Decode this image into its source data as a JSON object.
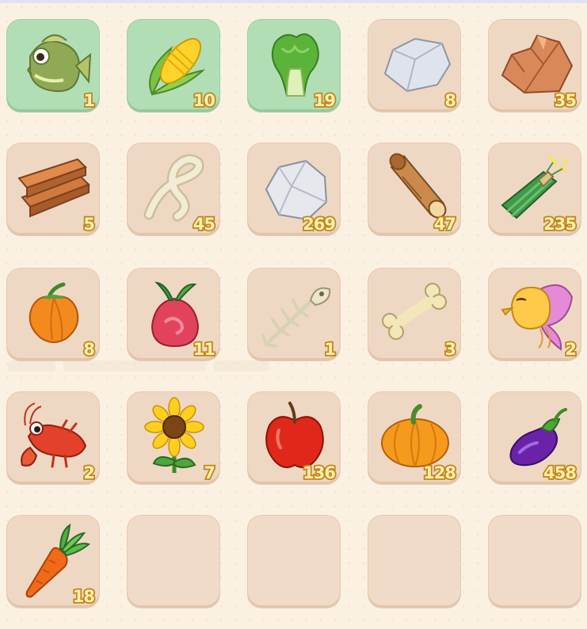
{
  "inventory": {
    "slots": [
      {
        "item": "fish-icon",
        "count": "1",
        "highlighted": true
      },
      {
        "item": "corn-icon",
        "count": "10",
        "highlighted": true
      },
      {
        "item": "lettuce-icon",
        "count": "19",
        "highlighted": true
      },
      {
        "item": "stone-icon",
        "count": "8",
        "highlighted": false
      },
      {
        "item": "copper-ore-icon",
        "count": "35",
        "highlighted": false
      },
      {
        "item": "wood-plank-icon",
        "count": "5",
        "highlighted": false
      },
      {
        "item": "fiber-icon",
        "count": "45",
        "highlighted": false
      },
      {
        "item": "rock-icon",
        "count": "269",
        "highlighted": false
      },
      {
        "item": "log-icon",
        "count": "47",
        "highlighted": false
      },
      {
        "item": "herb-bundle-icon",
        "count": "235",
        "highlighted": false
      },
      {
        "item": "orange-pepper-icon",
        "count": "8",
        "highlighted": false
      },
      {
        "item": "red-radish-icon",
        "count": "11",
        "highlighted": false
      },
      {
        "item": "fish-bone-icon",
        "count": "1",
        "highlighted": false
      },
      {
        "item": "bone-icon",
        "count": "3",
        "highlighted": false
      },
      {
        "item": "goldfish-icon",
        "count": "2",
        "highlighted": false
      },
      {
        "item": "lobster-icon",
        "count": "2",
        "highlighted": false
      },
      {
        "item": "sunflower-icon",
        "count": "7",
        "highlighted": false
      },
      {
        "item": "apple-icon",
        "count": "136",
        "highlighted": false
      },
      {
        "item": "pumpkin-icon",
        "count": "128",
        "highlighted": false
      },
      {
        "item": "eggplant-icon",
        "count": "458",
        "highlighted": false
      },
      {
        "item": "carrot-icon",
        "count": "18",
        "highlighted": false
      },
      {
        "item": "",
        "count": "",
        "highlighted": false
      },
      {
        "item": "",
        "count": "",
        "highlighted": false
      },
      {
        "item": "",
        "count": "",
        "highlighted": false
      },
      {
        "item": "",
        "count": "",
        "highlighted": false
      }
    ]
  },
  "colors": {
    "background": "#fbf1e3",
    "slot": "#eed8c3",
    "slot_highlight": "#b2deb6",
    "count_fill": "#fff0a8",
    "count_stroke": "#c0831c"
  }
}
